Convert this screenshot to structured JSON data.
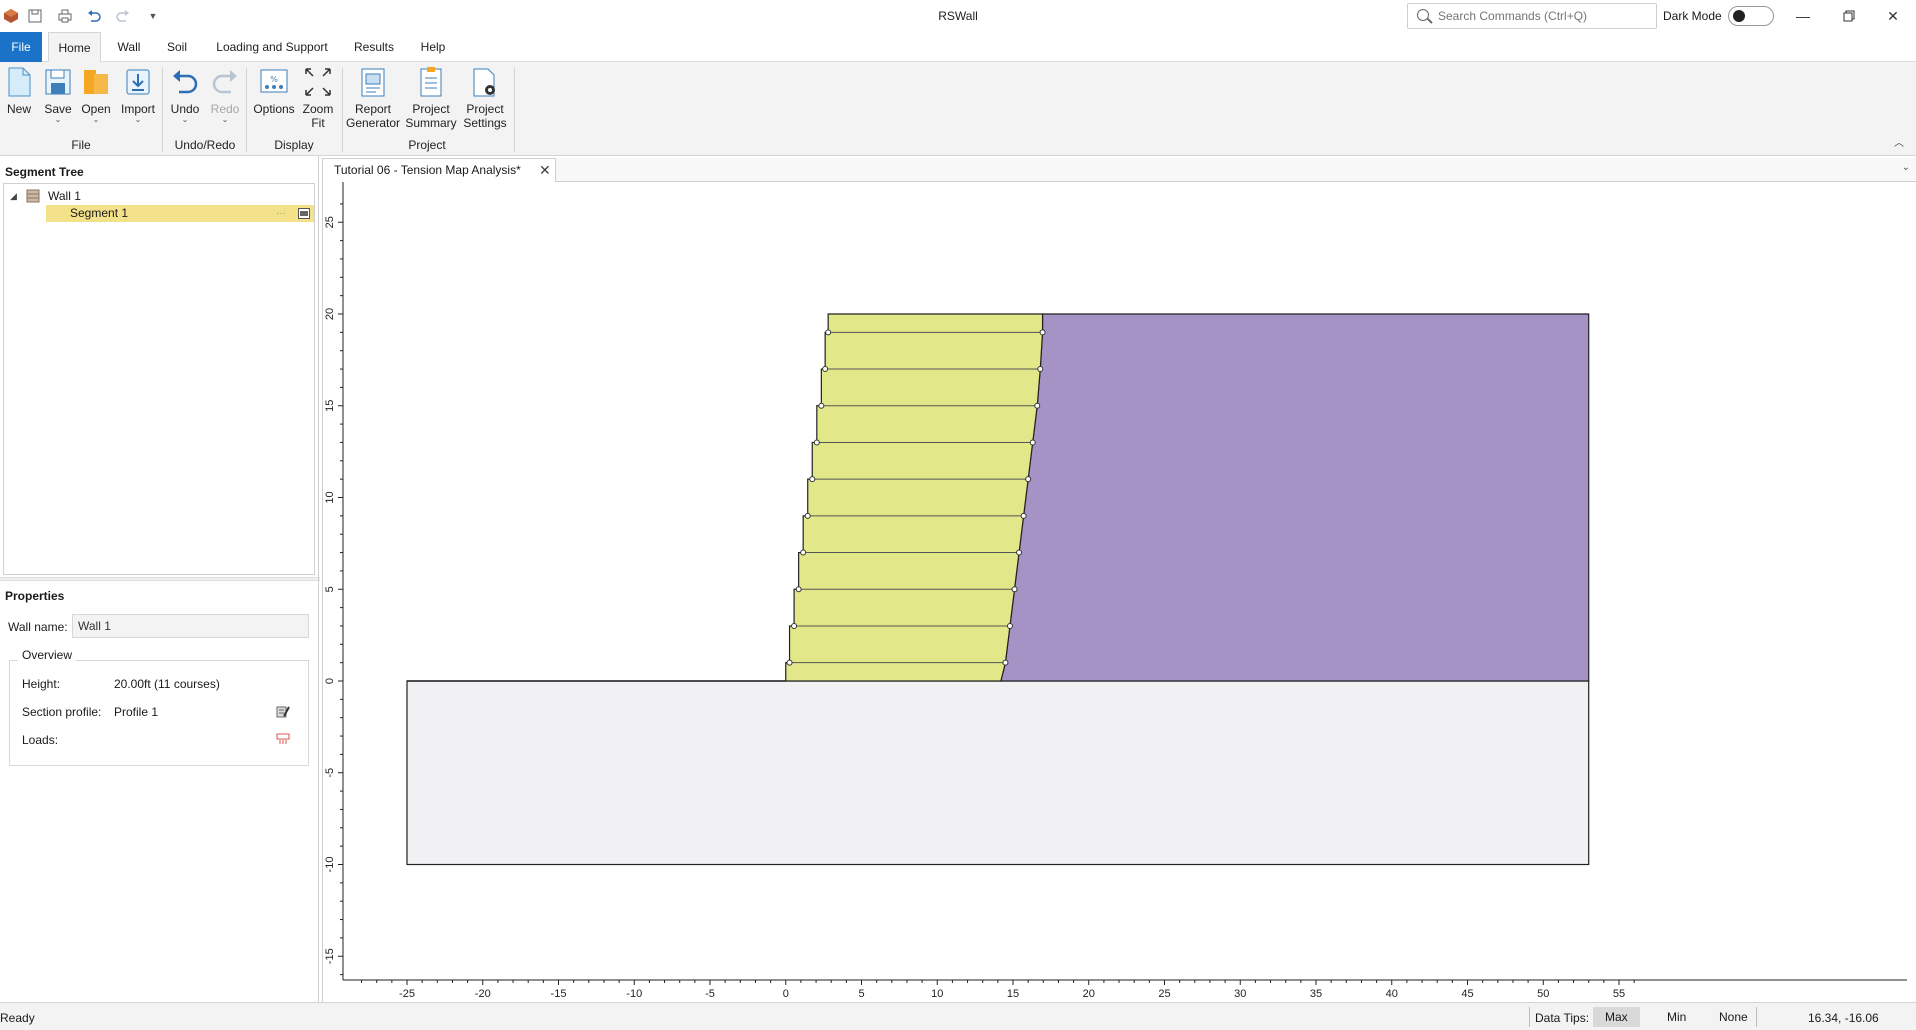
{
  "app": {
    "title": "RSWall",
    "search_placeholder": "Search Commands (Ctrl+Q)",
    "dark_mode_label": "Dark Mode"
  },
  "ribbon": {
    "tabs": [
      "File",
      "Home",
      "Wall",
      "Soil",
      "Loading and Support",
      "Results",
      "Help"
    ],
    "active_tab": "Home",
    "buttons": {
      "new": "New",
      "save": "Save",
      "open": "Open",
      "import": "Import",
      "undo": "Undo",
      "redo": "Redo",
      "options": "Options",
      "zoom_fit_1": "Zoom",
      "zoom_fit_2": "Fit",
      "report_1": "Report",
      "report_2": "Generator",
      "summary_1": "Project",
      "summary_2": "Summary",
      "settings_1": "Project",
      "settings_2": "Settings"
    },
    "groups": {
      "file": "File",
      "undo_redo": "Undo/Redo",
      "display": "Display",
      "project": "Project"
    }
  },
  "segment_tree": {
    "title": "Segment Tree",
    "wall": "Wall 1",
    "segment": "Segment 1"
  },
  "properties": {
    "title": "Properties",
    "wall_name_label": "Wall name:",
    "wall_name_value": "Wall 1",
    "overview_title": "Overview",
    "height_label": "Height:",
    "height_value": "20.00ft (11 courses)",
    "section_label": "Section profile:",
    "section_value": "Profile 1",
    "loads_label": "Loads:"
  },
  "document": {
    "tab_title": "Tutorial 06 - Tension Map Analysis*"
  },
  "chart_data": {
    "type": "diagram",
    "x_ticks": [
      -25,
      -20,
      -15,
      -10,
      -5,
      0,
      5,
      10,
      15,
      20,
      25,
      30,
      35,
      40,
      45,
      50,
      55
    ],
    "y_ticks": [
      -15,
      -10,
      -5,
      0,
      5,
      10,
      15,
      20,
      25
    ],
    "xlim": [
      -28,
      56
    ],
    "ylim": [
      -16.3,
      26.8
    ],
    "colors": {
      "wall": "#e2e88a",
      "backfill": "#a493c4",
      "foundation": "#f1f0f3"
    },
    "foundation_rect": {
      "x": [
        -25,
        53
      ],
      "y": [
        -10,
        0
      ]
    },
    "backfill_top": 20,
    "wall_height": 20,
    "courses": 11,
    "wall_front_x": [
      0,
      0.25,
      0.55,
      0.85,
      1.15,
      1.45,
      1.75,
      2.05,
      2.35,
      2.6,
      2.8,
      2.8
    ],
    "wall_back_x": [
      14.2,
      14.5,
      14.8,
      15.1,
      15.4,
      15.7,
      16.0,
      16.3,
      16.6,
      16.8,
      16.95,
      16.95
    ],
    "course_y": [
      0,
      1,
      3,
      5,
      7,
      9,
      11,
      13,
      15,
      17,
      19,
      20
    ]
  },
  "status": {
    "ready": "Ready",
    "data_tips_label": "Data Tips:",
    "data_tips_options": [
      "Max",
      "Min",
      "None"
    ],
    "data_tips_selected": "Max",
    "coords": "16.34, -16.06"
  }
}
